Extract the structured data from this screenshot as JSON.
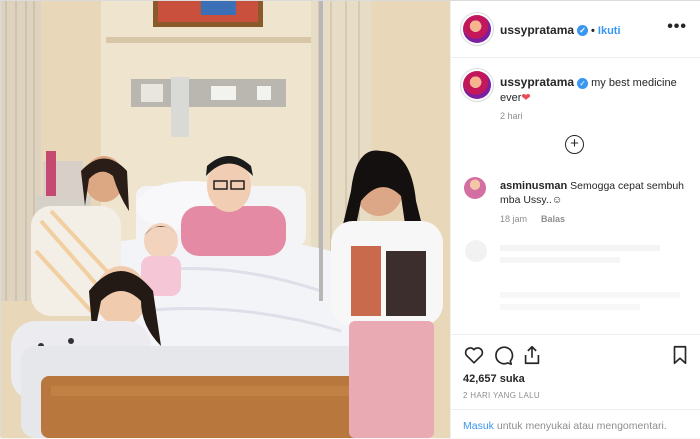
{
  "post": {
    "username": "ussypratama",
    "verified_mark": "✓",
    "dot": "•",
    "follow_label": "Ikuti",
    "more_label": "•••",
    "caption_text": "my best medicine ever",
    "caption_emoji": "❤",
    "caption_age": "2 hari",
    "load_more_label": "+",
    "likes": "42,657 suka",
    "posted_ago": "2 HARI YANG LALU"
  },
  "comment": {
    "username": "asminusman",
    "text": "Semogga cepat sembuh mba Ussy..",
    "emoji": "☺",
    "age": "18 jam",
    "reply_label": "Balas"
  },
  "login_prompt": {
    "link": "Masuk",
    "text": "untuk menyukai atau mengomentari."
  },
  "icons": [
    "heart-icon",
    "comment-icon",
    "share-icon",
    "bookmark-icon",
    "more-icon",
    "verified-icon"
  ],
  "colors": {
    "link": "#3897f0",
    "verified": "#3897f0",
    "heart": "#ed4956",
    "muted": "#8e8e8e"
  }
}
